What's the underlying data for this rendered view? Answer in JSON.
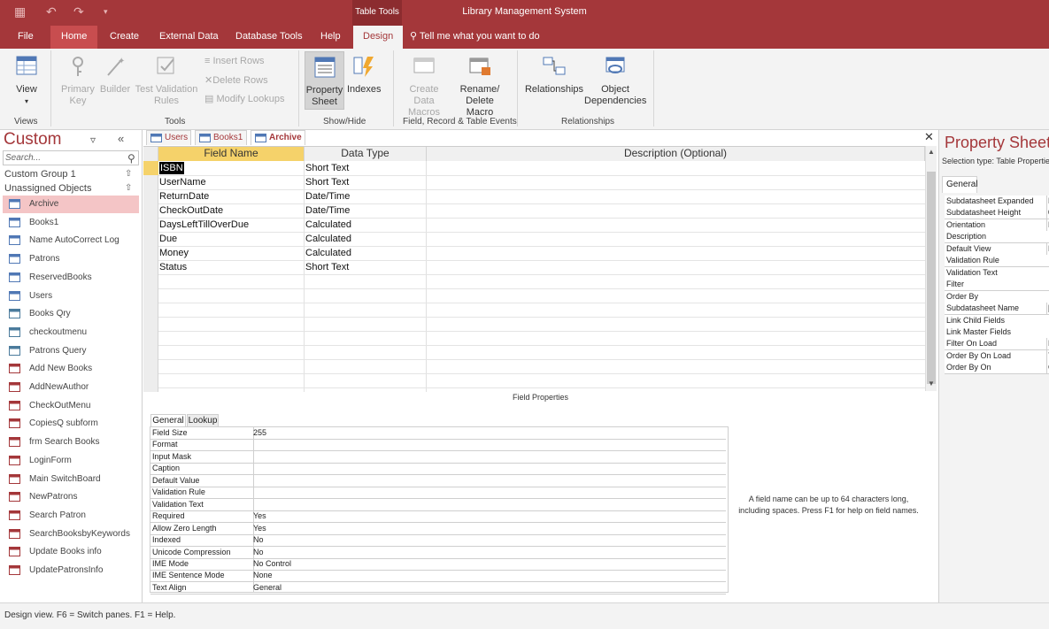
{
  "app": {
    "title": "Library Management System",
    "context_tab": "Table Tools"
  },
  "tabs": [
    "File",
    "Home",
    "Create",
    "External Data",
    "Database Tools",
    "Help",
    "Design"
  ],
  "tell_me": "Tell me what you want to do",
  "ribbon": {
    "view": "View",
    "primary_key": "Primary Key",
    "builder": "Builder",
    "test_validation": "Test Validation Rules",
    "insert_rows": "Insert Rows",
    "delete_rows": "Delete Rows",
    "modify_lookups": "Modify Lookups",
    "property_sheet": "Property Sheet",
    "indexes": "Indexes",
    "data_macros": "Create Data Macros",
    "rename_macro": "Rename/ Delete Macro",
    "relationships": "Relationships",
    "object_dependencies": "Object Dependencies",
    "groups": {
      "views": "Views",
      "tools": "Tools",
      "showhide": "Show/Hide",
      "events": "Field, Record & Table Events",
      "relationships": "Relationships"
    }
  },
  "nav": {
    "title": "Custom",
    "search_placeholder": "Search...",
    "group1": "Custom Group 1",
    "group2": "Unassigned Objects",
    "items": [
      "Archive",
      "Books1",
      "Name AutoCorrect Log",
      "Patrons",
      "ReservedBooks",
      "Users",
      "Books Qry",
      "checkoutmenu",
      "Patrons Query",
      "Add New Books",
      "AddNewAuthor",
      "CheckOutMenu",
      "CopiesQ subform",
      "frm Search Books",
      "LoginForm",
      "Main SwitchBoard",
      "NewPatrons",
      "Search Patron",
      "SearchBooksbyKeywords",
      "Update Books info",
      "UpdatePatronsInfo"
    ]
  },
  "doc_tabs": [
    "Users",
    "Books1",
    "Archive"
  ],
  "grid": {
    "headers": [
      "Field Name",
      "Data Type",
      "Description (Optional)"
    ],
    "rows": [
      [
        "ISBN",
        "Short Text"
      ],
      [
        "UserName",
        "Short Text"
      ],
      [
        "ReturnDate",
        "Date/Time"
      ],
      [
        "CheckOutDate",
        "Date/Time"
      ],
      [
        "DaysLeftTillOverDue",
        "Calculated"
      ],
      [
        "Due",
        "Calculated"
      ],
      [
        "Money",
        "Calculated"
      ],
      [
        "Status",
        "Short Text"
      ]
    ]
  },
  "field_properties": {
    "title": "Field Properties",
    "tabs": [
      "General",
      "Lookup"
    ],
    "rows": [
      [
        "Field Size",
        "255"
      ],
      [
        "Format",
        ""
      ],
      [
        "Input Mask",
        ""
      ],
      [
        "Caption",
        ""
      ],
      [
        "Default Value",
        ""
      ],
      [
        "Validation Rule",
        ""
      ],
      [
        "Validation Text",
        ""
      ],
      [
        "Required",
        "Yes"
      ],
      [
        "Allow Zero Length",
        "Yes"
      ],
      [
        "Indexed",
        "No"
      ],
      [
        "Unicode Compression",
        "No"
      ],
      [
        "IME Mode",
        "No Control"
      ],
      [
        "IME Sentence Mode",
        "None"
      ],
      [
        "Text Align",
        "General"
      ]
    ],
    "help": "A field name can be up to 64 characters long, including spaces. Press F1 for help on field names."
  },
  "property_sheet": {
    "title": "Property Sheet",
    "selection": "Selection type: Table Properties",
    "tab": "General",
    "rows": [
      "Subdatasheet Expanded",
      "Subdatasheet Height",
      "Orientation",
      "Description",
      "Default View",
      "Validation Rule",
      "Validation Text",
      "Filter",
      "Order By",
      "Subdatasheet Name",
      "Link Child Fields",
      "Link Master Fields",
      "Filter On Load",
      "Order By On Load",
      "Order By On"
    ],
    "value_hints": [
      "N",
      "0",
      "L",
      "",
      "D",
      "",
      "",
      "",
      "",
      "[A",
      "",
      "",
      "N",
      "Y",
      "O"
    ]
  },
  "status": "Design view.  F6 = Switch panes.  F1 = Help."
}
